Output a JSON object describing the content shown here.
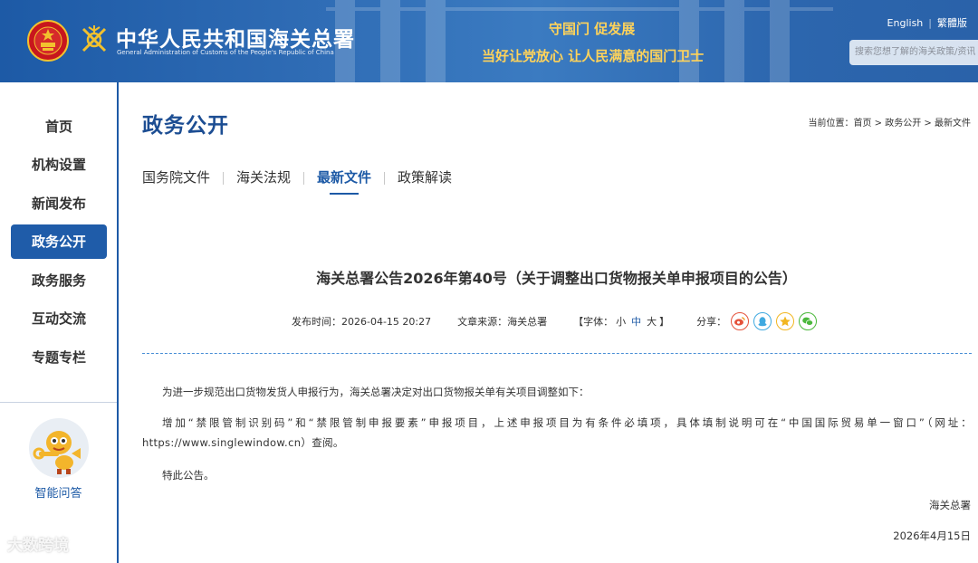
{
  "header": {
    "org_name_cn": "中华人民共和国海关总署",
    "org_name_en": "General Administration of Customs of the People's Republic of China",
    "slogan_line1": "守国门   促发展",
    "slogan_line2": "当好让党放心   让人民满意的国门卫士",
    "lang_english": "English",
    "lang_traditional": "繁體版",
    "search_placeholder": "搜索您想了解的海关政策/资讯",
    "colors": {
      "primary": "#1d5aa6",
      "slogan": "#ffd35a"
    }
  },
  "sidebar": {
    "items": [
      {
        "label": "首页"
      },
      {
        "label": "机构设置"
      },
      {
        "label": "新闻发布"
      },
      {
        "label": "政务公开"
      },
      {
        "label": "政务服务"
      },
      {
        "label": "互动交流"
      },
      {
        "label": "专题专栏"
      }
    ],
    "active_index": 3,
    "ai_qa_label": "智能问答",
    "watermark": "大数跨境"
  },
  "main": {
    "section_title": "政务公开",
    "breadcrumb": {
      "prefix": "当前位置：",
      "items": [
        "首页",
        "政务公开",
        "最新文件"
      ],
      "separator": " > "
    },
    "tabs": [
      {
        "label": "国务院文件"
      },
      {
        "label": "海关法规"
      },
      {
        "label": "最新文件"
      },
      {
        "label": "政策解读"
      }
    ],
    "active_tab": 2
  },
  "article": {
    "title": "海关总署公告2026年第40号（关于调整出口货物报关单申报项目的公告）",
    "publish_label": "发布时间：",
    "publish_time": "2026-04-15 20:27",
    "source_label": "文章来源：",
    "source": "海关总署",
    "font_label_open": "【字体：",
    "font_small": "小",
    "font_medium": "中",
    "font_large": "大",
    "font_label_close": "】",
    "share_label": "分享：",
    "share_icons": [
      "weibo-icon",
      "qq-icon",
      "qzone-icon",
      "wechat-icon"
    ],
    "paragraphs": [
      "为进一步规范出口货物发货人申报行为，海关总署决定对出口货物报关单有关项目调整如下：",
      "增加“禁限管制识别码”和“禁限管制申报要素”申报项目，上述申报项目为有条件必填项，具体填制说明可在“中国国际贸易单一窗口”（网址：https://www.singlewindow.cn）查阅。",
      "特此公告。"
    ],
    "signature": "海关总署",
    "sign_date": "2026年4月15日"
  }
}
